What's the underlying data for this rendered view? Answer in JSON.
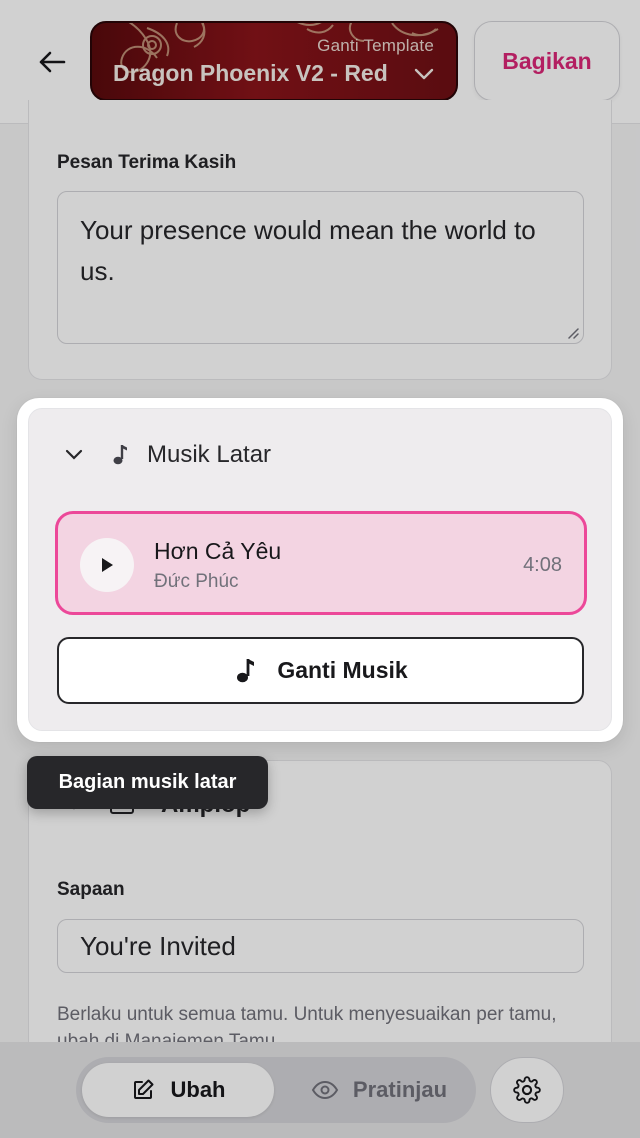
{
  "header": {
    "template_kicker": "Ganti Template",
    "template_name": "Dragon Phoenix V2 - Red",
    "share_label": "Bagikan"
  },
  "thanks_section": {
    "label": "Pesan Terima Kasih",
    "value": "Your presence would mean the world to us."
  },
  "music_section": {
    "title": "Musik Latar",
    "track": {
      "title": "Hơn Cả Yêu",
      "artist": "Đức Phúc",
      "duration": "4:08"
    },
    "change_label": "Ganti Musik"
  },
  "tooltip": {
    "text": "Bagian musik latar"
  },
  "envelope_section": {
    "title": "Amplop",
    "greeting_label": "Sapaan",
    "greeting_value": "You're Invited",
    "helper": "Berlaku untuk semua tamu. Untuk menyesuaikan per tamu, ubah di Manajemen Tamu."
  },
  "bottom_nav": {
    "edit_label": "Ubah",
    "preview_label": "Pratinjau"
  },
  "colors": {
    "accent": "#db2777",
    "track_border": "#ec4899",
    "track_bg": "#f3d4e2",
    "template_red": "#8a141a"
  },
  "icons": {
    "back": "arrow-left-icon",
    "dropdown": "chevron-down-icon",
    "music": "music-note-icon",
    "play": "play-icon",
    "envelope": "envelope-icon",
    "edit": "pencil-square-icon",
    "preview": "eye-icon",
    "settings": "gear-icon"
  }
}
